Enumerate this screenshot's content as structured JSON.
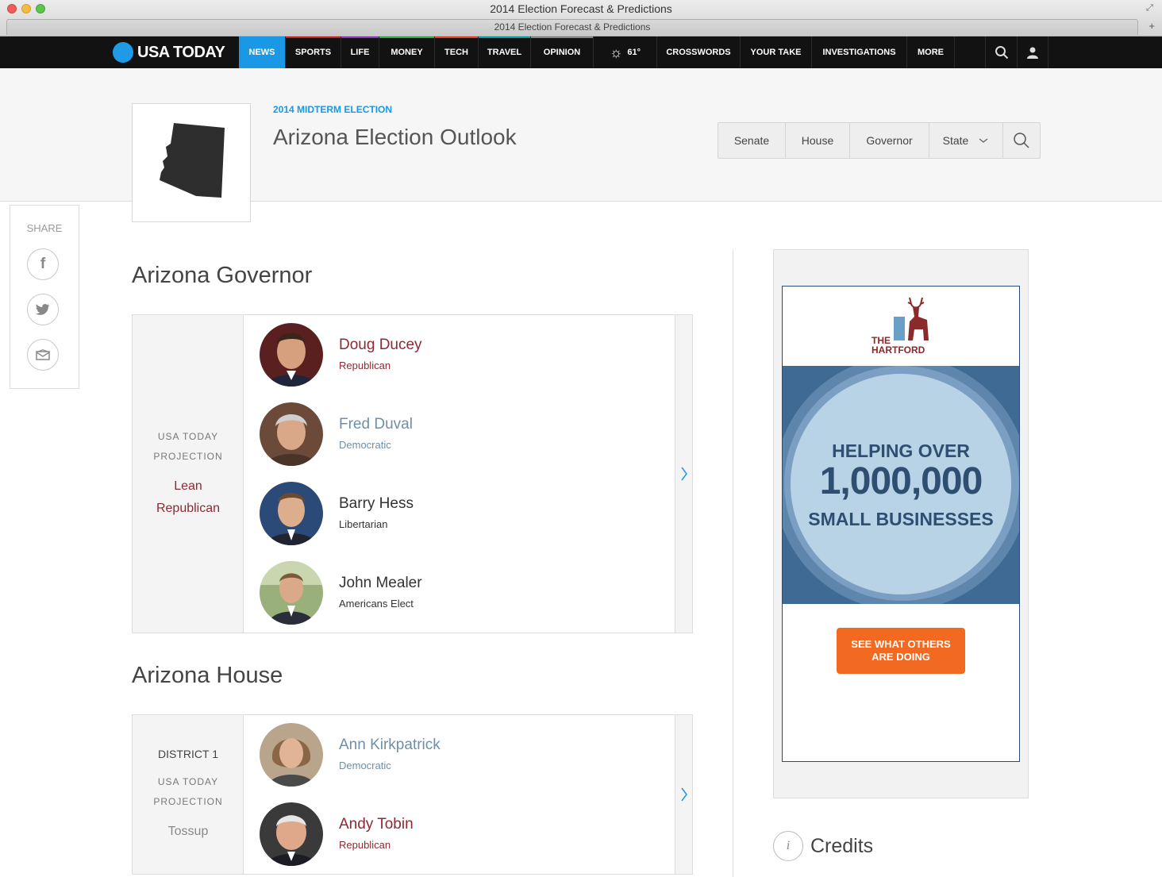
{
  "window": {
    "title": "2014 Election Forecast & Predictions",
    "tab_title": "2014 Election Forecast & Predictions"
  },
  "nav": {
    "logo": "USA TODAY",
    "items": [
      {
        "label": "NEWS",
        "active": true,
        "color": "#1a98e6"
      },
      {
        "label": "SPORTS",
        "color": "#c82323"
      },
      {
        "label": "LIFE",
        "color": "#8a3ab9"
      },
      {
        "label": "MONEY",
        "color": "#36a848"
      },
      {
        "label": "TECH",
        "color": "#e73e2c"
      },
      {
        "label": "TRAVEL",
        "color": "#00a6a6"
      },
      {
        "label": "OPINION",
        "color": "#888888"
      }
    ],
    "weather": "61°",
    "extra_items": [
      "CROSSWORDS",
      "YOUR TAKE",
      "INVESTIGATIONS",
      "MORE"
    ],
    "icons": [
      "search-icon",
      "user-icon"
    ]
  },
  "header": {
    "kicker": "2014 MIDTERM ELECTION",
    "title": "Arizona Election Outlook",
    "segments": [
      "Senate",
      "House",
      "Governor",
      "State"
    ]
  },
  "share": {
    "label": "SHARE",
    "buttons": [
      "facebook-icon",
      "twitter-icon",
      "email-icon"
    ]
  },
  "governor": {
    "section_title": "Arizona Governor",
    "projection_label_1": "USA TODAY",
    "projection_label_2": "PROJECTION",
    "projection_value_1": "Lean",
    "projection_value_2": "Republican",
    "candidates": [
      {
        "name": "Doug Ducey",
        "party": "Republican",
        "color": "#8b2a34"
      },
      {
        "name": "Fred Duval",
        "party": "Democratic",
        "color": "#6f8fa8"
      },
      {
        "name": "Barry Hess",
        "party": "Libertarian",
        "color": "#333333"
      },
      {
        "name": "John Mealer",
        "party": "Americans Elect",
        "color": "#333333"
      }
    ]
  },
  "house": {
    "section_title": "Arizona House",
    "district": "DISTRICT 1",
    "projection_label_1": "USA TODAY",
    "projection_label_2": "PROJECTION",
    "projection_value": "Tossup",
    "candidates": [
      {
        "name": "Ann Kirkpatrick",
        "party": "Democratic",
        "color": "#6f8fa8"
      },
      {
        "name": "Andy Tobin",
        "party": "Republican",
        "color": "#8b2a34"
      }
    ]
  },
  "ad": {
    "brand_line1": "THE",
    "brand_line2": "HARTFORD",
    "line1": "HELPING OVER",
    "line2": "1,000,000",
    "line3": "SMALL BUSINESSES",
    "cta": "SEE WHAT OTHERS ARE DOING"
  },
  "credits": {
    "label": "Credits"
  }
}
